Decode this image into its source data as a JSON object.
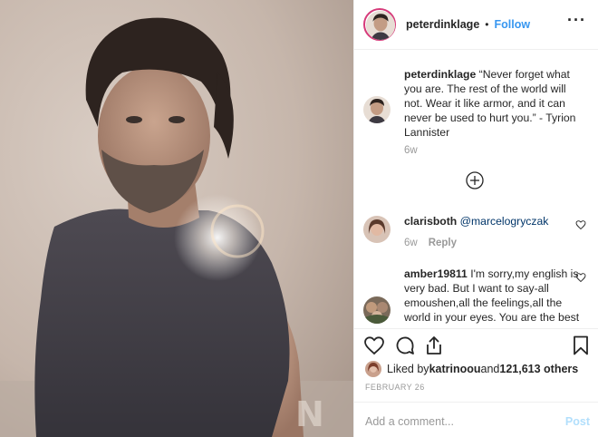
{
  "post": {
    "username": "peterdinklage",
    "separator": "•",
    "follow_label": "Follow",
    "more_icon": "more-dots-icon"
  },
  "caption": {
    "username": "peterdinklage",
    "text": " “Never forget what you are. The rest of the world will not. Wear it like armor, and it can never be used to hurt you.” - Tyrion Lannister",
    "age": "6w"
  },
  "comments": [
    {
      "username": "clarisboth",
      "mention": "@marcelogryczak",
      "age": "6w",
      "reply_label": "Reply"
    },
    {
      "username": "amber19811",
      "text": " I'm sorry,my english is very bad. But I want to say-all emoushen,all the feelings,all the world in your eyes. You are the best❤"
    }
  ],
  "load_more_icon": "plus-circle-icon",
  "likes": {
    "prefix": "Liked by ",
    "user": "katrinoou",
    "middle": " and ",
    "count": "121,613 others"
  },
  "date": "FEBRUARY 26",
  "add_comment": {
    "placeholder": "Add a comment...",
    "post_label": "Post"
  },
  "colors": {
    "link": "#3897f0",
    "mention": "#003569",
    "muted": "#999999",
    "post_disabled": "#b2dffc"
  }
}
